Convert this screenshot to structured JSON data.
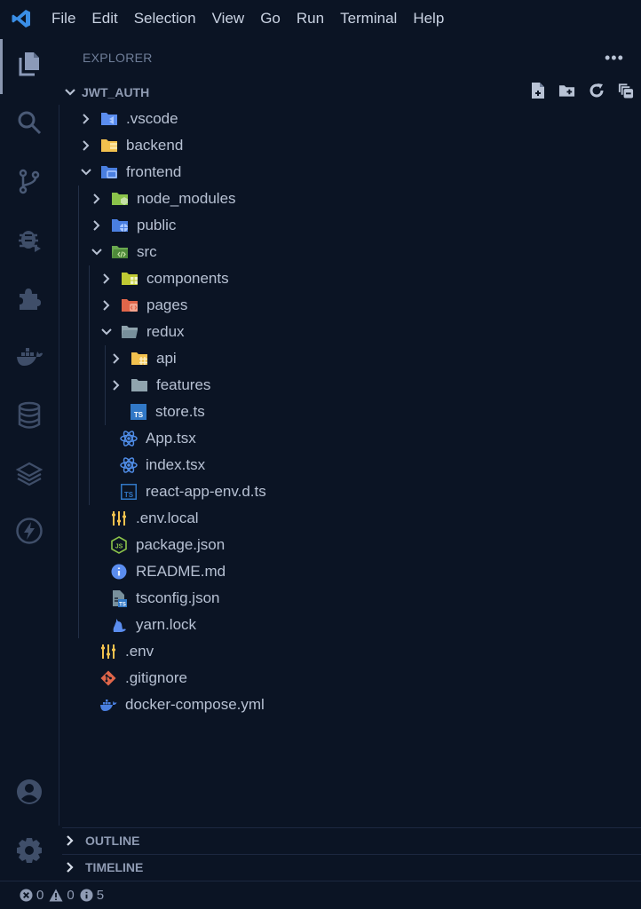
{
  "menubar": {
    "items": [
      "File",
      "Edit",
      "Selection",
      "View",
      "Go",
      "Run",
      "Terminal",
      "Help"
    ]
  },
  "activity_bar": {
    "items": [
      "explorer-icon",
      "search-icon",
      "source-control-icon",
      "run-debug-icon",
      "extensions-icon",
      "docker-icon",
      "database-icon",
      "layers-icon",
      "lightning-icon"
    ],
    "bottom": [
      "account-icon",
      "settings-gear-icon"
    ],
    "active": "explorer-icon"
  },
  "explorer": {
    "title": "EXPLORER",
    "more": "•••",
    "root": "JWT_AUTH",
    "actions": [
      "new-file-icon",
      "new-folder-icon",
      "refresh-icon",
      "collapse-all-icon"
    ]
  },
  "tree": [
    {
      "label": ".vscode",
      "type": "folder",
      "icon": "vscode-folder-icon",
      "depth": 0,
      "expanded": false
    },
    {
      "label": "backend",
      "type": "folder",
      "icon": "backend-folder-icon",
      "depth": 0,
      "expanded": false
    },
    {
      "label": "frontend",
      "type": "folder",
      "icon": "frontend-folder-icon",
      "depth": 0,
      "expanded": true
    },
    {
      "label": "node_modules",
      "type": "folder",
      "icon": "node-folder-icon",
      "depth": 1,
      "expanded": false
    },
    {
      "label": "public",
      "type": "folder",
      "icon": "public-folder-icon",
      "depth": 1,
      "expanded": false
    },
    {
      "label": "src",
      "type": "folder",
      "icon": "src-folder-icon",
      "depth": 1,
      "expanded": true
    },
    {
      "label": "components",
      "type": "folder",
      "icon": "components-folder-icon",
      "depth": 2,
      "expanded": false
    },
    {
      "label": "pages",
      "type": "folder",
      "icon": "pages-folder-icon",
      "depth": 2,
      "expanded": false
    },
    {
      "label": "redux",
      "type": "folder",
      "icon": "redux-folder-icon",
      "depth": 2,
      "expanded": true
    },
    {
      "label": "api",
      "type": "folder",
      "icon": "api-folder-icon",
      "depth": 3,
      "expanded": false
    },
    {
      "label": "features",
      "type": "folder",
      "icon": "folder-icon",
      "depth": 3,
      "expanded": false
    },
    {
      "label": "store.ts",
      "type": "file",
      "icon": "typescript-icon",
      "depth": 3
    },
    {
      "label": "App.tsx",
      "type": "file",
      "icon": "react-icon",
      "depth": 2
    },
    {
      "label": "index.tsx",
      "type": "file",
      "icon": "react-icon",
      "depth": 2
    },
    {
      "label": "react-app-env.d.ts",
      "type": "file",
      "icon": "typescript-def-icon",
      "depth": 2
    },
    {
      "label": ".env.local",
      "type": "file",
      "icon": "env-icon",
      "depth": 1
    },
    {
      "label": "package.json",
      "type": "file",
      "icon": "nodejs-icon",
      "depth": 1
    },
    {
      "label": "README.md",
      "type": "file",
      "icon": "info-icon",
      "depth": 1
    },
    {
      "label": "tsconfig.json",
      "type": "file",
      "icon": "tsconfig-icon",
      "depth": 1
    },
    {
      "label": "yarn.lock",
      "type": "file",
      "icon": "yarn-icon",
      "depth": 1
    },
    {
      "label": ".env",
      "type": "file",
      "icon": "env-icon",
      "depth": 0
    },
    {
      "label": ".gitignore",
      "type": "file",
      "icon": "git-icon",
      "depth": 0
    },
    {
      "label": "docker-compose.yml",
      "type": "file",
      "icon": "docker-icon",
      "depth": 0
    }
  ],
  "panels": [
    {
      "label": "OUTLINE"
    },
    {
      "label": "TIMELINE"
    }
  ],
  "status": {
    "errors": "0",
    "warnings": "0",
    "info": "5"
  },
  "colors": {
    "background": "#0b1424",
    "accent": "#3b82f6"
  }
}
